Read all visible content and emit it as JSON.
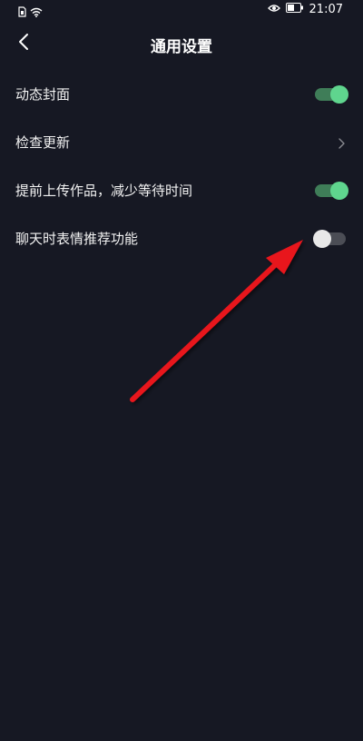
{
  "status_bar": {
    "time": "21:07",
    "icons": [
      "sim-card-icon",
      "wifi-icon",
      "eye-icon",
      "battery-icon"
    ]
  },
  "header": {
    "title": "通用设置",
    "back_icon": "chevron-left-icon"
  },
  "settings": [
    {
      "label": "动态封面",
      "control": "toggle",
      "state": "on"
    },
    {
      "label": "检查更新",
      "control": "chevron"
    },
    {
      "label": "提前上传作品，减少等待时间",
      "control": "toggle",
      "state": "on"
    },
    {
      "label": "聊天时表情推荐功能",
      "control": "toggle",
      "state": "off"
    }
  ],
  "colors": {
    "background": "#161823",
    "toggle_on_knob": "#5fd58e",
    "toggle_on_track": "#3f7d58",
    "toggle_off_knob": "#e8e8e8",
    "toggle_off_track": "#4b4d55",
    "annotation_arrow": "#e8141c"
  }
}
